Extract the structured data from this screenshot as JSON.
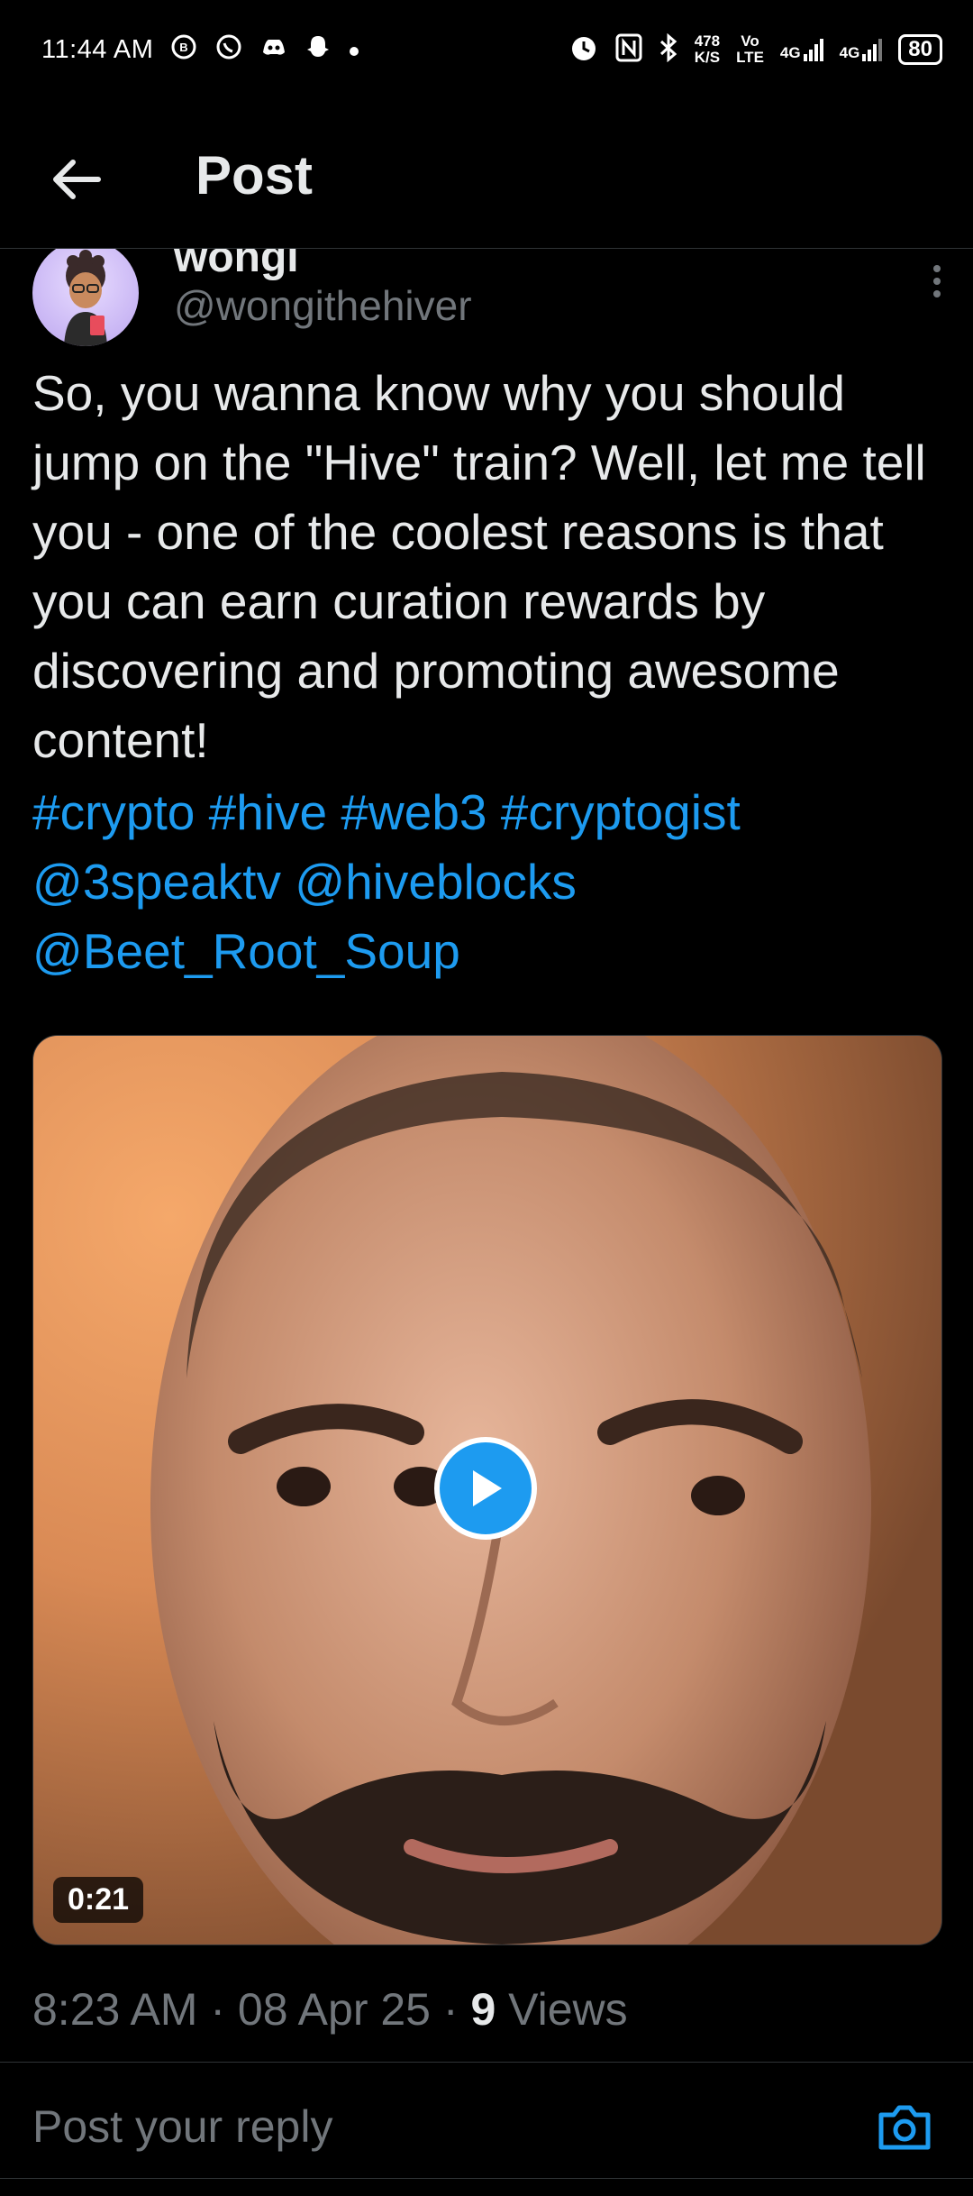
{
  "status_bar": {
    "time": "11:44 AM",
    "speed_value": "478",
    "speed_unit": "K/S",
    "volte_top": "Vo",
    "volte_bottom": "LTE",
    "net1": "4G",
    "net2": "4G",
    "battery": "80"
  },
  "header": {
    "title": "Post"
  },
  "author": {
    "name": "wongi",
    "handle": "@wongithehiver"
  },
  "post": {
    "text": "So, you wanna know why you should jump on the \"Hive\" train? Well, let me tell you - one of the coolest reasons is that you can earn curation rewards by discovering and promoting awesome content!",
    "hashtags": [
      "#crypto",
      "#hive",
      "#web3",
      "#cryptogist"
    ],
    "mentions": [
      "@3speaktv",
      "@hiveblocks",
      "@Beet_Root_Soup"
    ]
  },
  "media": {
    "duration": "0:21"
  },
  "meta": {
    "time": "8:23 AM",
    "sep1": "·",
    "date": "08 Apr 25",
    "sep2": "·",
    "views_count": "9",
    "views_label": "Views"
  },
  "reply": {
    "placeholder": "Post your reply"
  },
  "colors": {
    "accent": "#1d9bf0",
    "background": "#000000",
    "muted": "#71767b"
  }
}
